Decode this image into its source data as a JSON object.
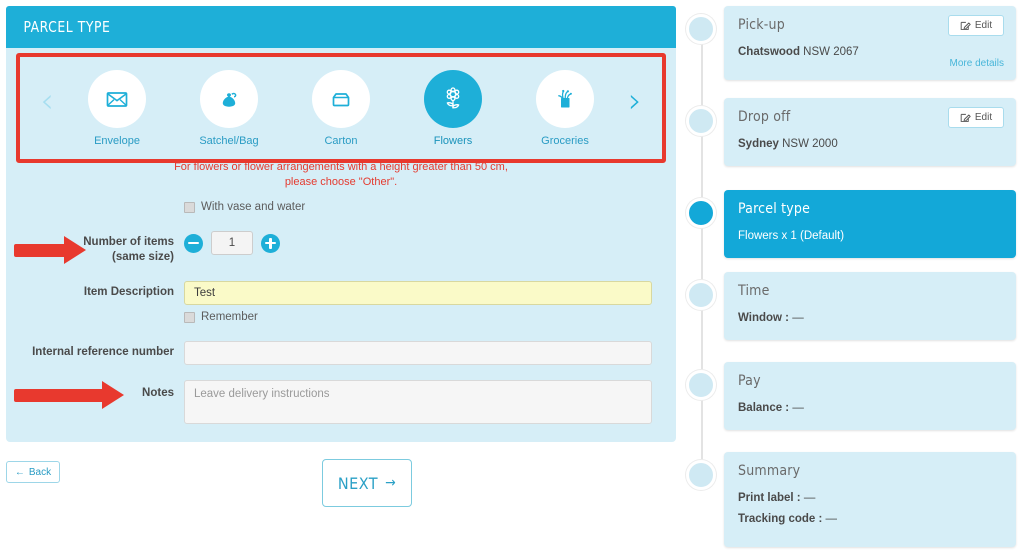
{
  "panel": {
    "header_title": "PARCEL TYPE",
    "warning_line1": "For flowers or flower arrangements with a height greater than 50 cm,",
    "warning_line2": "please choose \"Other\".",
    "prev_chevron": "‹",
    "next_chevron": "›"
  },
  "parcel_types": [
    {
      "label": "Envelope",
      "icon": "envelope-icon",
      "selected": false
    },
    {
      "label": "Satchel/Bag",
      "icon": "satchel-icon",
      "selected": false
    },
    {
      "label": "Carton",
      "icon": "carton-icon",
      "selected": false
    },
    {
      "label": "Flowers",
      "icon": "flowers-icon",
      "selected": true
    },
    {
      "label": "Groceries",
      "icon": "groceries-icon",
      "selected": false
    }
  ],
  "form": {
    "vase_checkbox_label": "With vase and water",
    "vase_checked": false,
    "number_of_items_label": "Number of items",
    "number_of_items_sublabel": "(same size)",
    "quantity_value": "1",
    "decrement_label": "−",
    "increment_label": "+",
    "item_description_label": "Item Description",
    "item_description_value": "Test",
    "remember_checkbox_label": "Remember",
    "remember_checked": false,
    "internal_reference_label": "Internal reference number",
    "internal_reference_value": "",
    "notes_label": "Notes",
    "notes_placeholder": "Leave delivery instructions",
    "notes_value": ""
  },
  "buttons": {
    "back_label": "Back",
    "back_arrow": "←",
    "next_label": "NEXT",
    "next_arrow": "→"
  },
  "timeline": [
    {
      "title": "Pick-up",
      "lines": [
        {
          "bold": "Chatswood",
          "rest": " NSW 2067"
        }
      ],
      "edit_label": "Edit",
      "more_label": "More details",
      "active": false
    },
    {
      "title": "Drop off",
      "lines": [
        {
          "bold": "Sydney",
          "rest": " NSW 2000"
        }
      ],
      "edit_label": "Edit",
      "more_label": "",
      "active": false
    },
    {
      "title": "Parcel type",
      "lines": [
        {
          "bold": "",
          "rest": "Flowers x 1 (Default)"
        }
      ],
      "edit_label": "",
      "more_label": "",
      "active": true
    },
    {
      "title": "Time",
      "lines": [
        {
          "bold": "Window :",
          "rest": " —"
        }
      ],
      "edit_label": "",
      "more_label": "",
      "active": false
    },
    {
      "title": "Pay",
      "lines": [
        {
          "bold": "Balance :",
          "rest": " —"
        }
      ],
      "edit_label": "",
      "more_label": "",
      "active": false
    },
    {
      "title": "Summary",
      "lines": [
        {
          "bold": "Print label :",
          "rest": " —"
        },
        {
          "bold": "Tracking code :",
          "rest": " —"
        }
      ],
      "edit_label": "",
      "more_label": "",
      "active": false
    }
  ],
  "colors": {
    "brand_blue": "#1eafd8",
    "panel_bg": "#d6eef7",
    "annotation_red": "#e8392e",
    "warning_red": "#e43b30",
    "highlight_yellow": "#fafac8"
  }
}
